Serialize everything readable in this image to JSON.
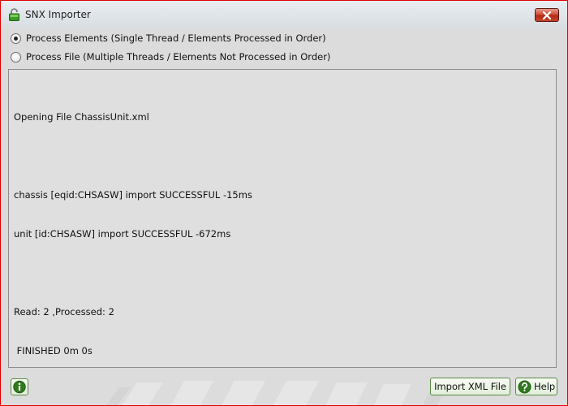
{
  "window": {
    "title": "SNX Importer"
  },
  "options": {
    "process_elements_label": "Process Elements (Single Thread / Elements Processed in Order)",
    "process_file_label": "Process File (Multiple Threads / Elements Not Processed in Order)",
    "selected": "process_elements"
  },
  "log": {
    "lines": [
      "Opening File ChassisUnit.xml",
      "",
      "chassis [eqid:CHSASW] import SUCCESSFUL -15ms",
      "unit [id:CHSASW] import SUCCESSFUL -672ms",
      "",
      "Read: 2 ,Processed: 2",
      " FINISHED 0m 0s"
    ]
  },
  "footer": {
    "import_button_label": "Import XML File",
    "help_button_label": "Help"
  },
  "icons": {
    "app": "lock-icon",
    "close": "close-icon",
    "info": "info-icon",
    "help": "help-icon"
  },
  "colors": {
    "window_border": "#e00000",
    "close_button": "#c7452c",
    "button_border": "#5a8a44",
    "icon_green": "#2f7a1c",
    "background": "#dcdcdc"
  }
}
